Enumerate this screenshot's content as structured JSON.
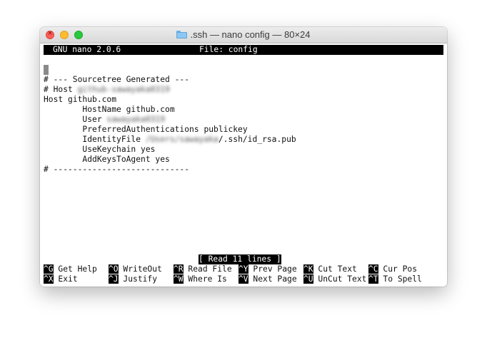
{
  "window": {
    "title": ".ssh — nano config — 80×24"
  },
  "nano": {
    "version": "GNU nano 2.0.6",
    "file_label": "File: config",
    "status": "[ Read 11 lines ]"
  },
  "file_lines": {
    "l1": "",
    "l2": "# --- Sourcetree Generated ---",
    "l3_prefix": "# Host ",
    "l3_redacted": "github-sawayaka0319",
    "l4": "Host github.com",
    "l5": "        HostName github.com",
    "l6_prefix": "        User ",
    "l6_redacted": "sawayaka0319",
    "l7": "        PreferredAuthentications publickey",
    "l8_prefix": "        IdentityFile ",
    "l8_redacted": "/Users/sawayaka",
    "l8_suffix": "/.ssh/id_rsa.pub",
    "l9": "        UseKeychain yes",
    "l10": "        AddKeysToAgent yes",
    "l11": "# ----------------------------"
  },
  "shortcuts": {
    "row1": [
      {
        "key": "^G",
        "label": " Get Help"
      },
      {
        "key": "^O",
        "label": " WriteOut"
      },
      {
        "key": "^R",
        "label": " Read File"
      },
      {
        "key": "^Y",
        "label": " Prev Page"
      },
      {
        "key": "^K",
        "label": " Cut Text"
      },
      {
        "key": "^C",
        "label": " Cur Pos"
      }
    ],
    "row2": [
      {
        "key": "^X",
        "label": " Exit"
      },
      {
        "key": "^J",
        "label": " Justify"
      },
      {
        "key": "^W",
        "label": " Where Is"
      },
      {
        "key": "^V",
        "label": " Next Page"
      },
      {
        "key": "^U",
        "label": " UnCut Text"
      },
      {
        "key": "^T",
        "label": " To Spell"
      }
    ]
  }
}
